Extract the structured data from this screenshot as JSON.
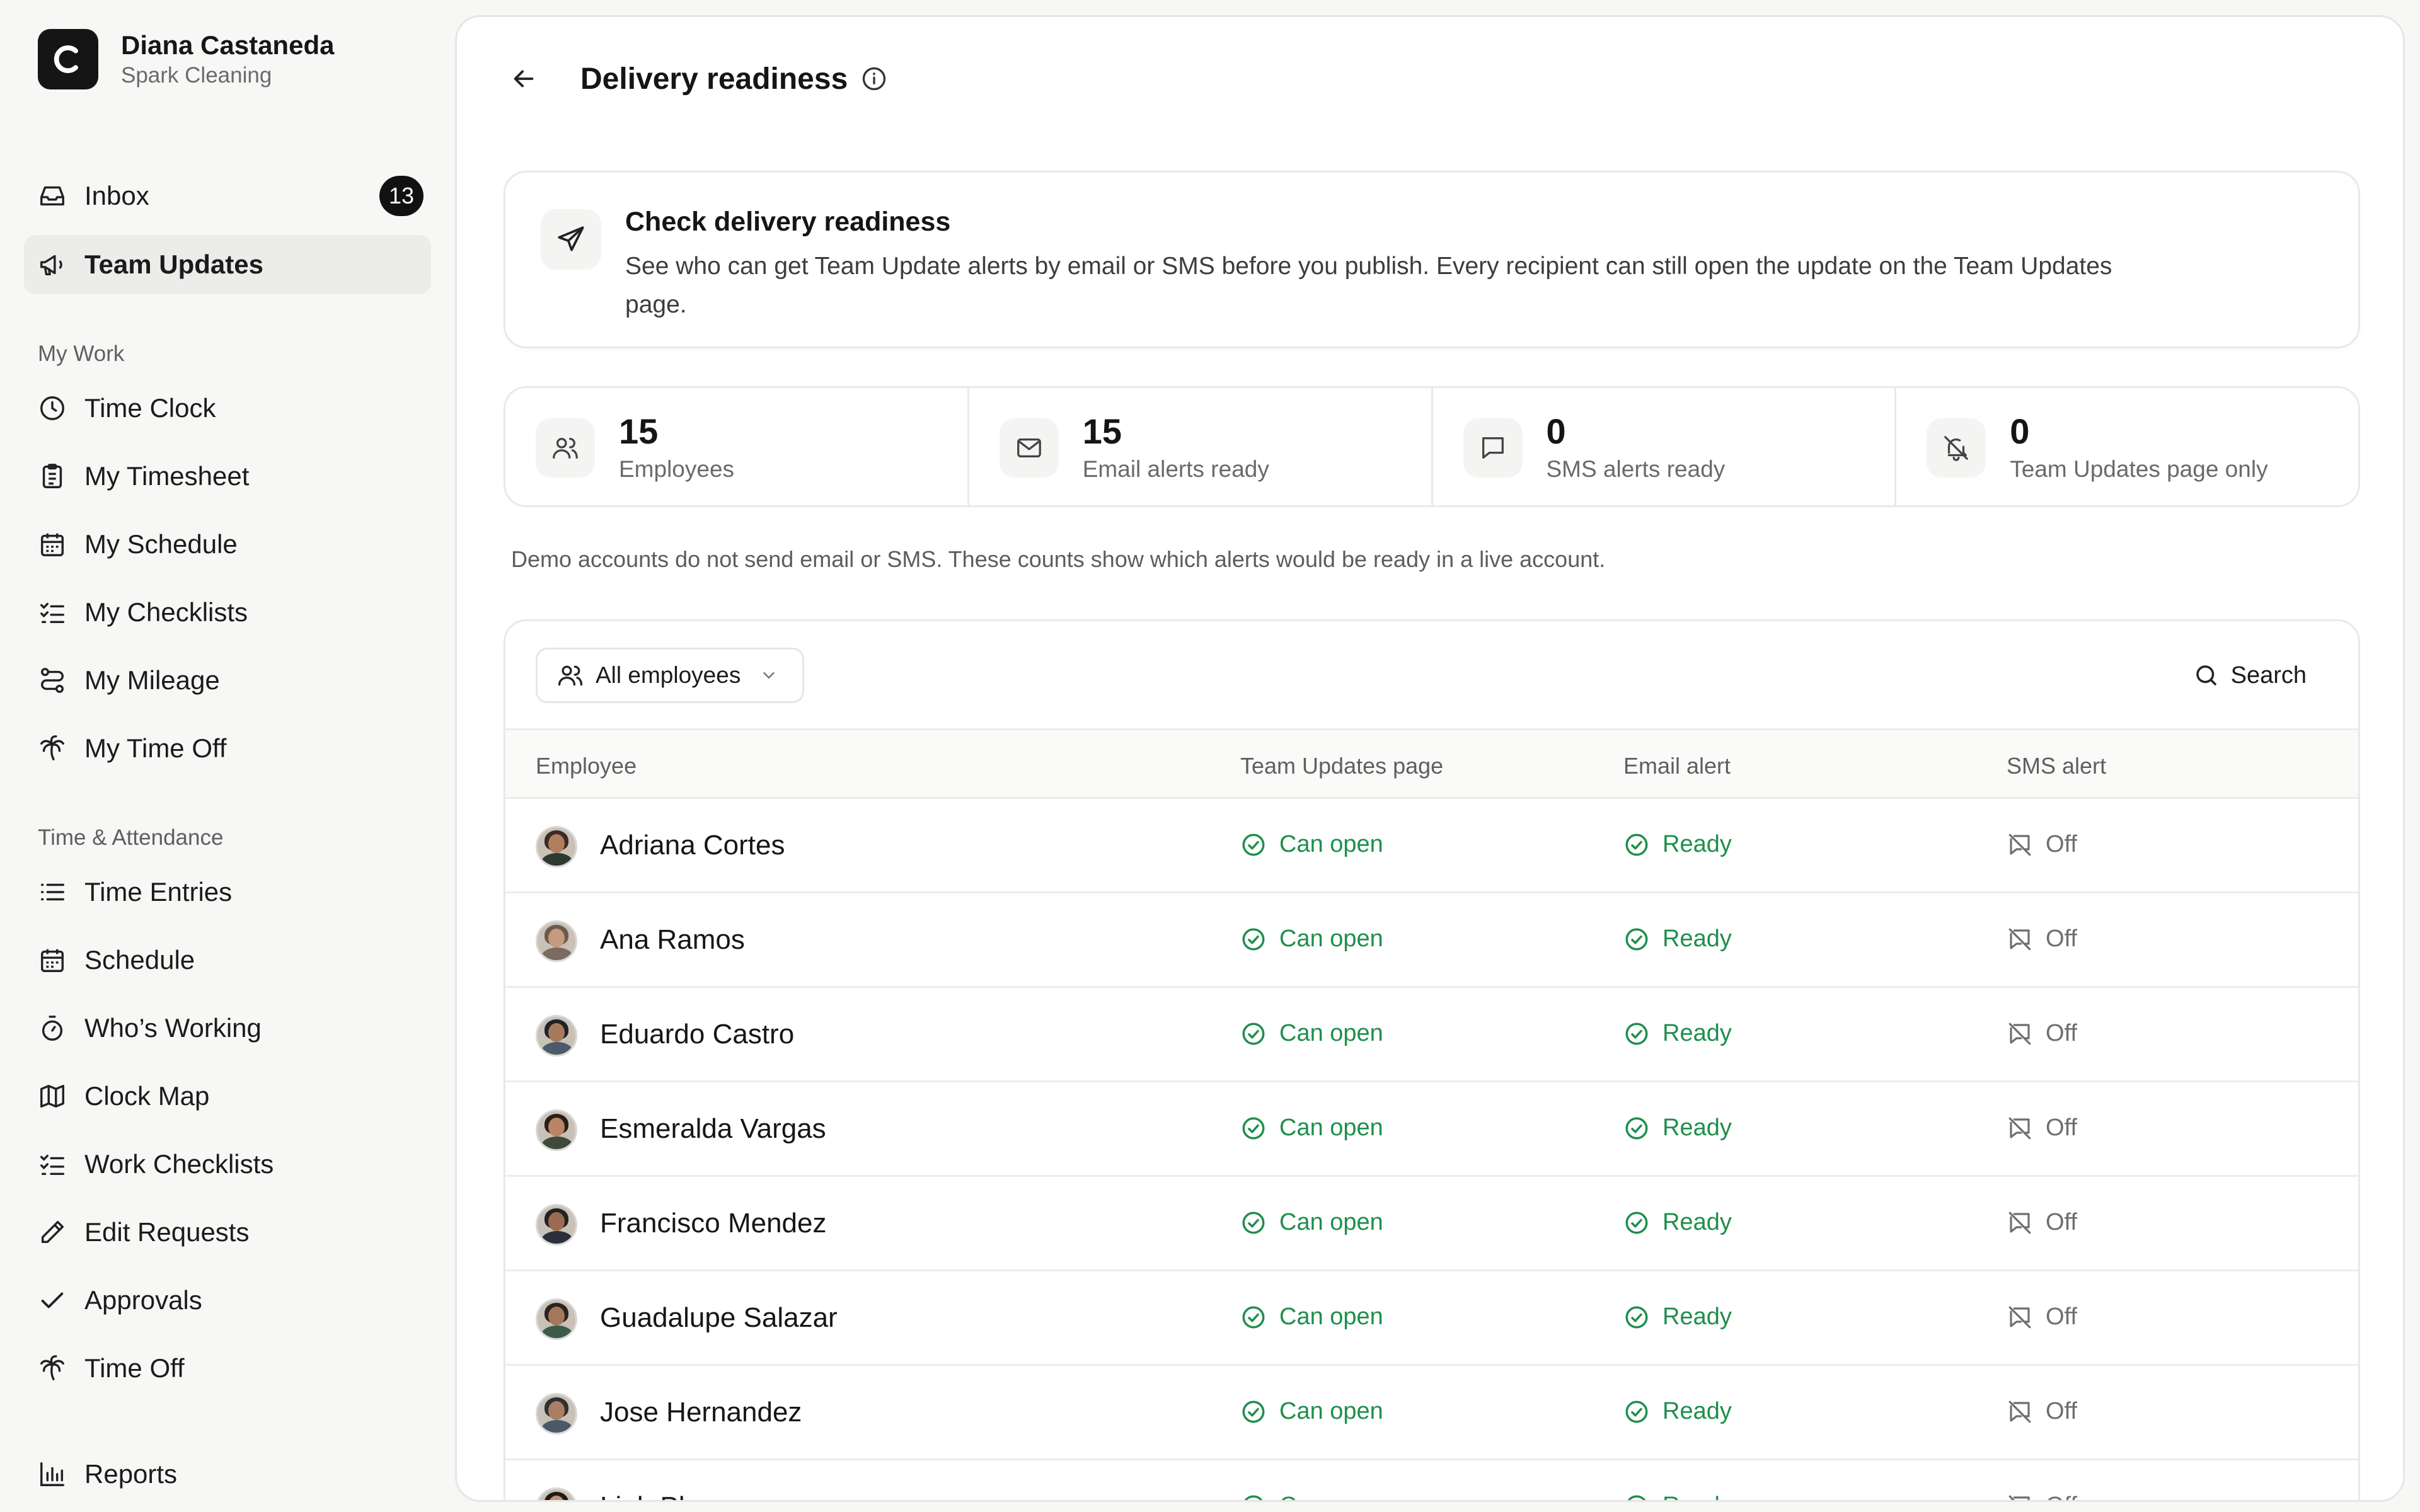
{
  "account": {
    "name": "Diana Castaneda",
    "org": "Spark Cleaning",
    "logo_letter": "C"
  },
  "nav": {
    "inbox": {
      "label": "Inbox",
      "badge": "13"
    },
    "team_updates": {
      "label": "Team Updates"
    },
    "sections": {
      "my_work": "My Work",
      "time_attendance": "Time & Attendance"
    },
    "my_work": [
      "Time Clock",
      "My Timesheet",
      "My Schedule",
      "My Checklists",
      "My Mileage",
      "My Time Off"
    ],
    "time_attendance": [
      "Time Entries",
      "Schedule",
      "Who’s Working",
      "Clock Map",
      "Work Checklists",
      "Edit Requests",
      "Approvals",
      "Time Off"
    ],
    "reports": "Reports"
  },
  "page": {
    "title": "Delivery readiness"
  },
  "info_card": {
    "title": "Check delivery readiness",
    "text": "See who can get Team Update alerts by email or SMS before you publish. Every recipient can still open the update on the Team Updates page."
  },
  "stats": [
    {
      "value": "15",
      "label": "Employees",
      "icon": "users-icon"
    },
    {
      "value": "15",
      "label": "Email alerts ready",
      "icon": "mail-icon"
    },
    {
      "value": "0",
      "label": "SMS alerts ready",
      "icon": "message-icon"
    },
    {
      "value": "0",
      "label": "Team Updates page only",
      "icon": "bell-off-icon"
    }
  ],
  "demo_note": "Demo accounts do not send email or SMS. These counts show which alerts would be ready in a live account.",
  "table": {
    "filter_label": "All employees",
    "search_label": "Search",
    "headers": {
      "employee": "Employee",
      "page": "Team Updates page",
      "email": "Email alert",
      "sms": "SMS alert"
    },
    "rows": [
      {
        "name": "Adriana Cortes",
        "page": "Can open",
        "email": "Ready",
        "sms": "Off"
      },
      {
        "name": "Ana Ramos",
        "page": "Can open",
        "email": "Ready",
        "sms": "Off"
      },
      {
        "name": "Eduardo Castro",
        "page": "Can open",
        "email": "Ready",
        "sms": "Off"
      },
      {
        "name": "Esmeralda Vargas",
        "page": "Can open",
        "email": "Ready",
        "sms": "Off"
      },
      {
        "name": "Francisco Mendez",
        "page": "Can open",
        "email": "Ready",
        "sms": "Off"
      },
      {
        "name": "Guadalupe Salazar",
        "page": "Can open",
        "email": "Ready",
        "sms": "Off"
      },
      {
        "name": "Jose Hernandez",
        "page": "Can open",
        "email": "Ready",
        "sms": "Off"
      },
      {
        "name": "Linh Pham",
        "page": "Can open",
        "email": "Ready",
        "sms": "Off"
      }
    ]
  },
  "colors": {
    "ready_green": "#1f8f4c",
    "off_gray": "#6e6e6e",
    "active_nav_bg": "#ececea"
  }
}
